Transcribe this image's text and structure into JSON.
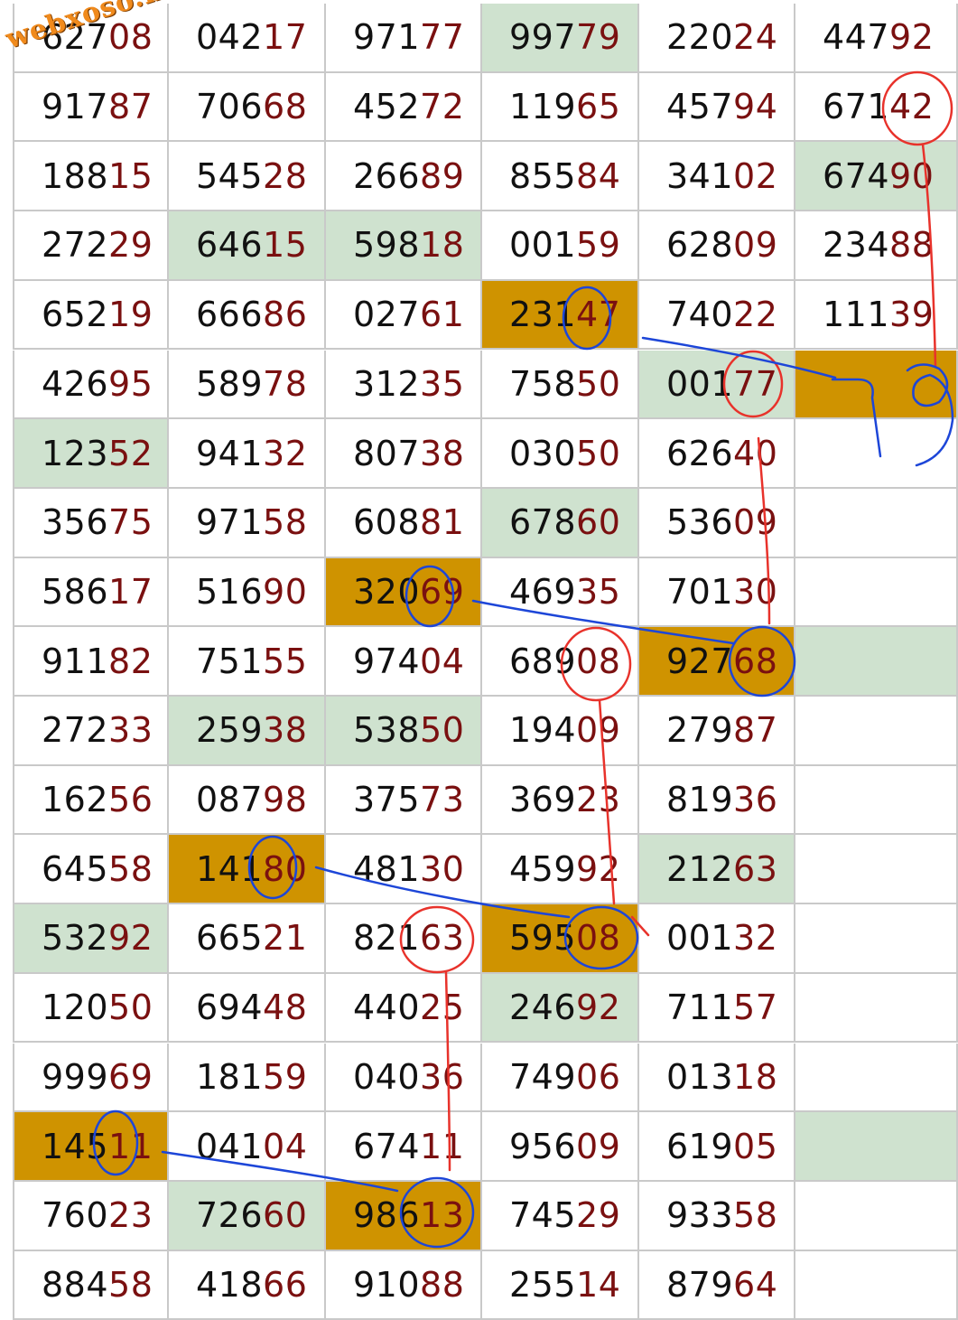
{
  "watermark": "webxoso.net",
  "colors": {
    "green": "#cfe2cf",
    "orange": "#cf9300",
    "prefix": "#111111",
    "suffix": "#7a1010",
    "grid_line": "#c9c9c9",
    "annot_red": "#e8322b",
    "annot_blue": "#1d46d8"
  },
  "table": {
    "rows": [
      [
        {
          "v": "62708"
        },
        {
          "v": "04217"
        },
        {
          "v": "97177"
        },
        {
          "v": "99779",
          "h": "green"
        },
        {
          "v": "22024"
        },
        {
          "v": "44792"
        }
      ],
      [
        {
          "v": "91787"
        },
        {
          "v": "70668"
        },
        {
          "v": "45272"
        },
        {
          "v": "11965"
        },
        {
          "v": "45794"
        },
        {
          "v": "67142"
        }
      ],
      [
        {
          "v": "18815"
        },
        {
          "v": "54528"
        },
        {
          "v": "26689"
        },
        {
          "v": "85584"
        },
        {
          "v": "34102"
        },
        {
          "v": "67490",
          "h": "green"
        }
      ],
      [
        {
          "v": "27229"
        },
        {
          "v": "64615",
          "h": "green"
        },
        {
          "v": "59818",
          "h": "green"
        },
        {
          "v": "00159"
        },
        {
          "v": "62809"
        },
        {
          "v": "23488"
        }
      ],
      [
        {
          "v": "65219"
        },
        {
          "v": "66686"
        },
        {
          "v": "02761"
        },
        {
          "v": "23147",
          "h": "orange"
        },
        {
          "v": "74022"
        },
        {
          "v": "11139"
        }
      ],
      [
        {
          "v": "42695"
        },
        {
          "v": "58978"
        },
        {
          "v": "31235"
        },
        {
          "v": "75850"
        },
        {
          "v": "00177",
          "h": "green"
        },
        {
          "v": "",
          "h": "orange"
        }
      ],
      [
        {
          "v": "12352",
          "h": "green"
        },
        {
          "v": "94132"
        },
        {
          "v": "80738"
        },
        {
          "v": "03050"
        },
        {
          "v": "62640"
        },
        {
          "v": ""
        }
      ],
      [
        {
          "v": "35675"
        },
        {
          "v": "97158"
        },
        {
          "v": "60881"
        },
        {
          "v": "67860",
          "h": "green"
        },
        {
          "v": "53609"
        },
        {
          "v": ""
        }
      ],
      [
        {
          "v": "58617"
        },
        {
          "v": "51690"
        },
        {
          "v": "32069",
          "h": "orange"
        },
        {
          "v": "46935"
        },
        {
          "v": "70130"
        },
        {
          "v": ""
        }
      ],
      [
        {
          "v": "91182"
        },
        {
          "v": "75155"
        },
        {
          "v": "97404"
        },
        {
          "v": "68908"
        },
        {
          "v": "92768",
          "h": "orange"
        },
        {
          "v": "",
          "h": "green"
        }
      ],
      [
        {
          "v": "27233"
        },
        {
          "v": "25938",
          "h": "green"
        },
        {
          "v": "53850",
          "h": "green"
        },
        {
          "v": "19409"
        },
        {
          "v": "27987"
        },
        {
          "v": ""
        }
      ],
      [
        {
          "v": "16256"
        },
        {
          "v": "08798"
        },
        {
          "v": "37573"
        },
        {
          "v": "36923"
        },
        {
          "v": "81936"
        },
        {
          "v": ""
        }
      ],
      [
        {
          "v": "64558"
        },
        {
          "v": "14180",
          "h": "orange"
        },
        {
          "v": "48130"
        },
        {
          "v": "45992"
        },
        {
          "v": "21263",
          "h": "green"
        },
        {
          "v": ""
        }
      ],
      [
        {
          "v": "53292",
          "h": "green"
        },
        {
          "v": "66521"
        },
        {
          "v": "82163"
        },
        {
          "v": "59508",
          "h": "orange"
        },
        {
          "v": "00132"
        },
        {
          "v": ""
        }
      ],
      [
        {
          "v": "12050"
        },
        {
          "v": "69448"
        },
        {
          "v": "44025"
        },
        {
          "v": "24692",
          "h": "green"
        },
        {
          "v": "71157"
        },
        {
          "v": ""
        }
      ],
      [
        {
          "v": "99969"
        },
        {
          "v": "18159"
        },
        {
          "v": "04036"
        },
        {
          "v": "74906"
        },
        {
          "v": "01318"
        },
        {
          "v": ""
        }
      ],
      [
        {
          "v": "14511",
          "h": "orange"
        },
        {
          "v": "04104"
        },
        {
          "v": "67411"
        },
        {
          "v": "95609"
        },
        {
          "v": "61905"
        },
        {
          "v": "",
          "h": "green"
        }
      ],
      [
        {
          "v": "76023"
        },
        {
          "v": "72660",
          "h": "green"
        },
        {
          "v": "98613",
          "h": "orange"
        },
        {
          "v": "74529"
        },
        {
          "v": "93358"
        },
        {
          "v": ""
        }
      ],
      [
        {
          "v": "88458"
        },
        {
          "v": "41866"
        },
        {
          "v": "91088"
        },
        {
          "v": "25514"
        },
        {
          "v": "87964"
        },
        {
          "v": ""
        }
      ]
    ]
  },
  "annotation_text": "79"
}
